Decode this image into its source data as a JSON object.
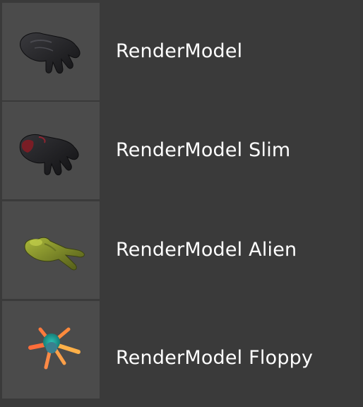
{
  "items": [
    {
      "label": "RenderModel",
      "icon": "glove-icon",
      "colors": {
        "base": "#1f1f22",
        "accent": "#2c2c30"
      }
    },
    {
      "label": "RenderModel Slim",
      "icon": "glove-slim-icon",
      "colors": {
        "base": "#1e1e20",
        "accent": "#7a1d25"
      }
    },
    {
      "label": "RenderModel Alien",
      "icon": "alien-hand-icon",
      "colors": {
        "base": "#5f6a1e",
        "accent": "#a6b537"
      }
    },
    {
      "label": "RenderModel Floppy",
      "icon": "floppy-hand-icon",
      "colors": {
        "base": "#1fa39a",
        "accent": "#ff8a3c"
      }
    }
  ]
}
